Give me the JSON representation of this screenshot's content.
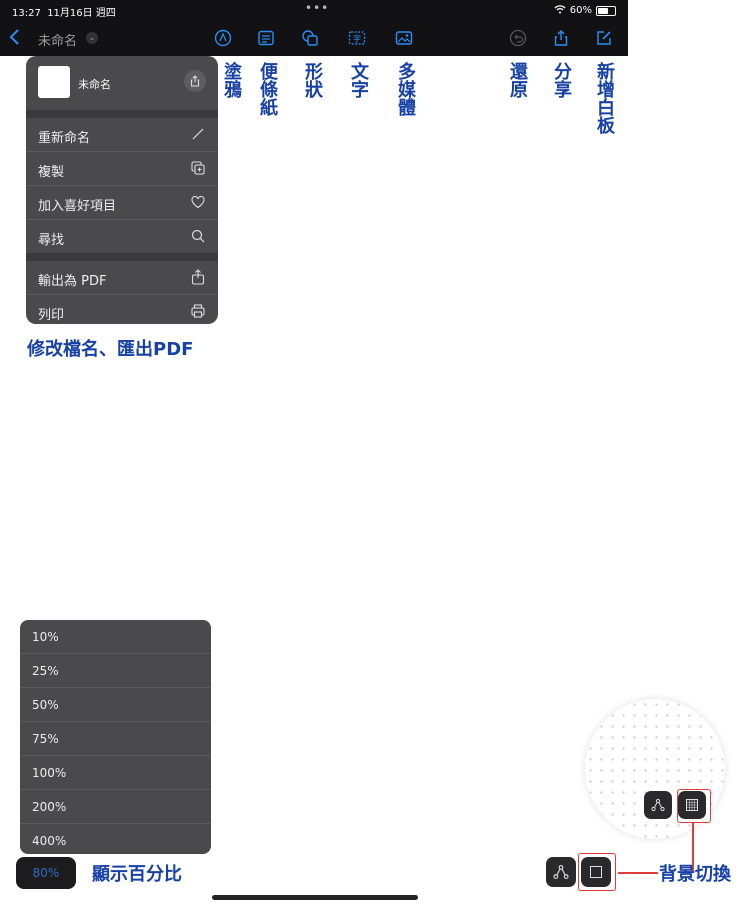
{
  "status": {
    "time": "13:27",
    "date": "11月16日 週四",
    "battery": "60%"
  },
  "header": {
    "doc_title": "未命名"
  },
  "annotations": {
    "draw": "塗鴉",
    "sticky": "便條紙",
    "shape": "形狀",
    "text": "文字",
    "media": "多媒體",
    "undo": "還原",
    "share": "分享",
    "new_board": "新增白板",
    "rename_export": "修改檔名、匯出PDF",
    "zoom_percent": "顯示百分比",
    "bg_toggle": "背景切換"
  },
  "file_menu": {
    "name": "未命名",
    "items": [
      {
        "label": "重新命名",
        "icon": "pencil-icon"
      },
      {
        "label": "複製",
        "icon": "duplicate-icon"
      },
      {
        "label": "加入喜好項目",
        "icon": "heart-icon"
      },
      {
        "label": "尋找",
        "icon": "search-icon"
      }
    ],
    "items2": [
      {
        "label": "輸出為 PDF",
        "icon": "export-icon"
      },
      {
        "label": "列印",
        "icon": "print-icon"
      }
    ]
  },
  "zoom_menu": {
    "options": [
      "10%",
      "25%",
      "50%",
      "75%",
      "100%",
      "200%",
      "400%"
    ],
    "current": "80%"
  },
  "colors": {
    "accent": "#2a8df7",
    "annotation": "#1741a5",
    "highlight": "#e23b3b"
  }
}
